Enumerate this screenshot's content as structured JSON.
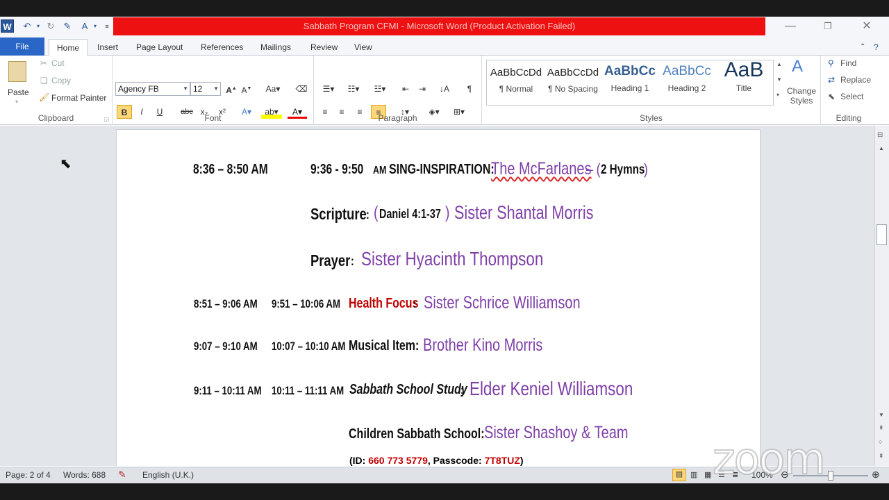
{
  "window": {
    "title": "Sabbath Program CFMI  -  Microsoft Word (Product Activation Failed)"
  },
  "tabs": [
    "File",
    "Home",
    "Insert",
    "Page Layout",
    "References",
    "Mailings",
    "Review",
    "View"
  ],
  "ribbon": {
    "clipboard": {
      "paste": "Paste",
      "cut": "Cut",
      "copy": "Copy",
      "format_painter": "Format Painter",
      "label": "Clipboard"
    },
    "font": {
      "name": "Agency FB",
      "size": "12",
      "label": "Font"
    },
    "paragraph": {
      "label": "Paragraph"
    },
    "styles": {
      "items": [
        {
          "sample": "AaBbCcDd",
          "name": "¶ Normal"
        },
        {
          "sample": "AaBbCcDd",
          "name": "¶ No Spacing"
        },
        {
          "sample": "AaBbCc",
          "name": "Heading 1"
        },
        {
          "sample": "AaBbCc",
          "name": "Heading 2"
        },
        {
          "sample": "AaB",
          "name": "Title"
        }
      ],
      "change_styles": "Change Styles",
      "label": "Styles"
    },
    "editing": {
      "find": "Find",
      "replace": "Replace",
      "select": "Select",
      "label": "Editing"
    }
  },
  "document": {
    "row1": {
      "time1": "8:36  – 8:50  AM",
      "time2": "9:36  - 9:50",
      "am": "AM",
      "label": "SING-INSPIRATION:",
      "name": "The McFarlanes",
      "extra": "– (",
      "extra2": "2 Hymns",
      "extra3": ")"
    },
    "row2": {
      "label": "Scripture",
      "colon": ":",
      "paren_open": "(",
      "ref": "Daniel 4:1-37",
      "paren_close": ")",
      "name": "Sister Shantal Morris"
    },
    "row3": {
      "label": "Prayer",
      "colon": ":",
      "name": "Sister Hyacinth Thompson"
    },
    "row4": {
      "time1": "8:51 – 9:06 AM",
      "time2": "9:51 – 10:06 AM",
      "label": "Health Focus",
      "colon": ":",
      "name": "Sister Schrice Williamson"
    },
    "row5": {
      "time1": "9:07 – 9:10 AM",
      "time2": "10:07 – 10:10 AM",
      "label": "Musical Item:",
      "name": "Brother Kino Morris"
    },
    "row6": {
      "time1": "9:11 – 10:11 AM",
      "time2": "10:11 – 11:11 AM",
      "label": "Sabbath School Study",
      "colon": ":",
      "name": "Elder Keniel Williamson"
    },
    "row7": {
      "label": "Children Sabbath School:",
      "name": "Sister Shashoy & Team"
    },
    "row8": {
      "id_label": "(ID:",
      "id": "660 773 5779",
      "pass_label": ", Passcode:",
      "pass": "7T8TUZ",
      "close": ")"
    }
  },
  "status": {
    "page": "Page: 2 of 4",
    "words": "Words: 688",
    "language": "English (U.K.)",
    "zoom": "100%"
  },
  "watermark": "zoom"
}
